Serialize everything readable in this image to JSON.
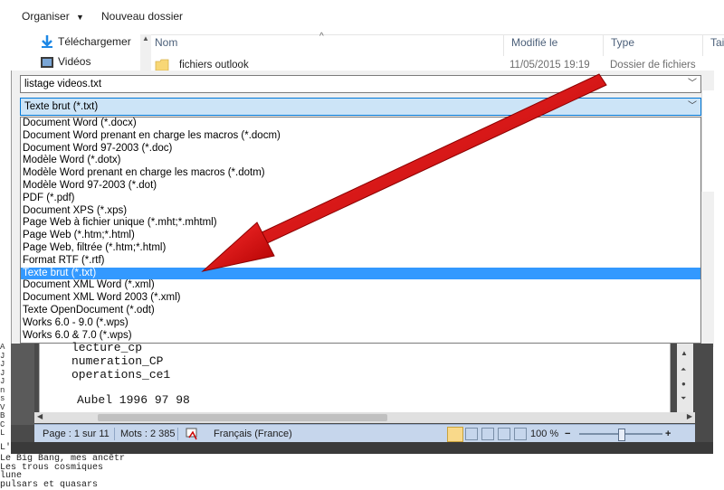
{
  "explorer": {
    "toolbar": {
      "organize_label": "Organiser",
      "new_folder_label": "Nouveau dossier"
    },
    "nav": [
      {
        "label": "Téléchargemer",
        "icon": "download-arrow-icon"
      },
      {
        "label": "Vidéos",
        "icon": "video-folder-icon"
      }
    ],
    "columns": {
      "name": "Nom",
      "modified": "Modifié le",
      "type": "Type",
      "size": "Tai"
    },
    "rows": [
      {
        "name": "fichiers outlook",
        "modified": "11/05/2015 19:19",
        "type": "Dossier de fichiers"
      }
    ]
  },
  "save_dialog": {
    "filename": "listage videos.txt",
    "file_type": "Texte brut (*.txt)",
    "file_type_options": [
      "Document Word (*.docx)",
      "Document Word prenant en charge les macros (*.docm)",
      "Document Word 97-2003 (*.doc)",
      "Modèle Word (*.dotx)",
      "Modèle Word prenant en charge les macros (*.dotm)",
      "Modèle Word 97-2003 (*.dot)",
      "PDF (*.pdf)",
      "Document XPS (*.xps)",
      "Page Web à fichier unique (*.mht;*.mhtml)",
      "Page Web (*.htm;*.html)",
      "Page Web, filtrée (*.htm;*.html)",
      "Format RTF (*.rtf)",
      "Texte brut (*.txt)",
      "Document XML Word (*.xml)",
      "Document XML Word 2003 (*.xml)",
      "Texte OpenDocument (*.odt)",
      "Works 6.0 - 9.0 (*.wps)",
      "Works 6.0 & 7.0 (*.wps)"
    ],
    "selected_index": 12
  },
  "word": {
    "doc_lines": [
      "lecture_cp",
      "numeration_CP",
      "operations_ce1",
      "",
      "Aubel 1996 97 98"
    ],
    "status": {
      "page": "Page : 1 sur 11",
      "words": "Mots : 2 385",
      "language": "Français (France)",
      "zoom": "100 %",
      "zoom_out": "−",
      "zoom_in": "+"
    }
  },
  "background_text": [
    "L'a",
    "Le Big Bang, mes ancêtr",
    "Les trous cosmiques",
    "lune",
    "pulsars et quasars"
  ],
  "left_fragments": [
    "A",
    "J",
    "J",
    "J",
    "J",
    "n",
    "s",
    "",
    "V",
    "B",
    "C",
    "L",
    "H"
  ],
  "annotation": {
    "arrow_color": "#e81010"
  }
}
